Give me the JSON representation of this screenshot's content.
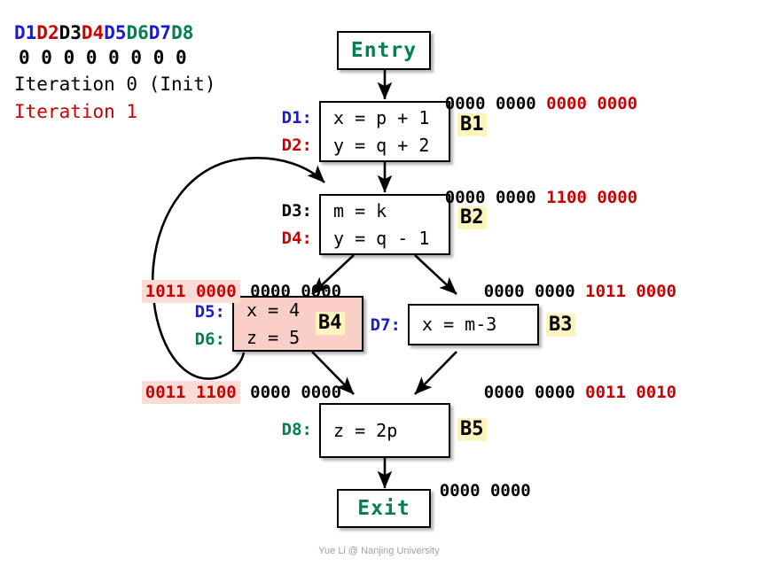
{
  "legend": {
    "defs": [
      {
        "label": "D1",
        "color": "#1a1ad1"
      },
      {
        "label": "D2",
        "color": "#cc0000"
      },
      {
        "label": "D3",
        "color": "#000000"
      },
      {
        "label": "D4",
        "color": "#cc0000"
      },
      {
        "label": "D5",
        "color": "#1a1ad1"
      },
      {
        "label": "D6",
        "color": "#00814b"
      },
      {
        "label": "D7",
        "color": "#1a1ad1"
      },
      {
        "label": "D8",
        "color": "#00814b"
      }
    ],
    "bits": "0 0 0 0 0 0 0 0",
    "iteration_0": "Iteration 0 (Init)",
    "iteration_1": "Iteration 1"
  },
  "nodes": {
    "entry": {
      "label": "Entry"
    },
    "exit": {
      "label": "Exit"
    },
    "b1": {
      "tag": "B1",
      "statements": [
        {
          "id": "D1:",
          "id_color": "#1a1ad1",
          "text": "x = p + 1"
        },
        {
          "id": "D2:",
          "id_color": "#cc0000",
          "text": "y = q + 2"
        }
      ]
    },
    "b2": {
      "tag": "B2",
      "statements": [
        {
          "id": "D3:",
          "id_color": "#000000",
          "text": "m = k"
        },
        {
          "id": "D4:",
          "id_color": "#cc0000",
          "text": "y = q - 1"
        }
      ]
    },
    "b4": {
      "tag": "B4",
      "highlighted": true,
      "statements": [
        {
          "id": "D5:",
          "id_color": "#1a1ad1",
          "text": "x = 4"
        },
        {
          "id": "D6:",
          "id_color": "#00814b",
          "text": "z = 5"
        }
      ]
    },
    "b3": {
      "tag": "B3",
      "statements": [
        {
          "id": "D7:",
          "id_color": "#1a1ad1",
          "text": "x = m-3"
        }
      ]
    },
    "b5": {
      "tag": "B5",
      "statements": [
        {
          "id": "D8:",
          "id_color": "#00814b",
          "text": "z = 2p"
        }
      ]
    }
  },
  "annotations": {
    "entry_out": {
      "black": "0000 0000",
      "red": "0000 0000",
      "red_highlight": false
    },
    "b1_out": {
      "black": "0000 0000",
      "red": "1100 0000",
      "red_highlight": false
    },
    "b2_out_left": {
      "red": "1011 0000",
      "black": "0000 0000",
      "red_highlight": true
    },
    "b2_out_right": {
      "black": "0000 0000",
      "red": "1011 0000",
      "red_highlight": false
    },
    "b4_out": {
      "red": "0011 1100",
      "black": "0000 0000",
      "red_highlight": true
    },
    "b3_out": {
      "black": "0000 0000",
      "red": "0011 0010",
      "red_highlight": false
    },
    "b5_out": {
      "black": "0000 0000",
      "red": "",
      "red_highlight": false
    }
  },
  "footer": {
    "credit": "Yue Li @ Nanjing University"
  },
  "colors": {
    "blue": "#1a1ad1",
    "red": "#cc0000",
    "green": "#00814b",
    "black": "#000000",
    "pink_fill": "#f9cfc7",
    "pink_highlight": "#fadcd6",
    "yellow_tag": "#fcf4bd"
  }
}
